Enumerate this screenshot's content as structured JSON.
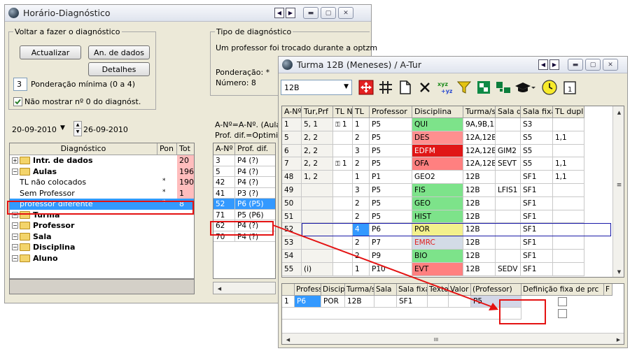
{
  "main_window": {
    "title": "Horário-Diagnóstico",
    "redo_group": {
      "label": "Voltar a fazer o diagnóstico",
      "update_button": "Actualizar",
      "analysis_button": "An. de dados",
      "details_button": "Detalhes",
      "min_weight_value": "3",
      "min_weight_label": "Ponderação mínima (0 a 4)",
      "hide_zero_label": "Não mostrar nº 0 do diagnóst."
    },
    "date_from": "20-09-2010",
    "date_to": "26-09-2010",
    "diag_type_group": {
      "label": "Tipo de diagnóstico",
      "description": "Um professor foi trocado durante a optzm",
      "weight_label": "Ponderação: *",
      "number_label": "Número: 8"
    },
    "legend_line1": "A-Nº=A-Nº. (Aula",
    "legend_line2": "Prof. dif.=Optimiz.",
    "tree": {
      "headers": [
        "Diagnóstico",
        "Pon",
        "Tot"
      ],
      "rows": [
        {
          "label": "Intr. de dados",
          "pon": "",
          "tot": "20",
          "bold": true,
          "folder": true,
          "expander": "+"
        },
        {
          "label": "Aulas",
          "pon": "",
          "tot": "196",
          "bold": true,
          "folder": true,
          "expander": "-"
        },
        {
          "label": "TL não colocados",
          "pon": "*",
          "tot": "190",
          "bold": false,
          "folder": false,
          "expander": ""
        },
        {
          "label": "Sem Professor",
          "pon": "*",
          "tot": "1",
          "bold": false,
          "folder": false,
          "expander": ""
        },
        {
          "label": "professor diferente",
          "pon": "*",
          "tot": "8",
          "bold": false,
          "folder": false,
          "expander": "",
          "selected": true
        },
        {
          "label": "Turma",
          "pon": "",
          "tot": "",
          "bold": true,
          "folder": true,
          "expander": "-"
        },
        {
          "label": "Professor",
          "pon": "",
          "tot": "",
          "bold": true,
          "folder": true,
          "expander": "-"
        },
        {
          "label": "Sala",
          "pon": "",
          "tot": "",
          "bold": true,
          "folder": true,
          "expander": "-"
        },
        {
          "label": "Disciplina",
          "pon": "",
          "tot": "",
          "bold": true,
          "folder": true,
          "expander": "-"
        },
        {
          "label": "Aluno",
          "pon": "",
          "tot": "",
          "bold": true,
          "folder": true,
          "expander": "-"
        }
      ]
    },
    "diff_list": {
      "headers": [
        "A-Nº",
        "Prof. dif."
      ],
      "rows": [
        {
          "an": "3",
          "prof": "P4 (?)"
        },
        {
          "an": "5",
          "prof": "P4 (?)"
        },
        {
          "an": "42",
          "prof": "P4 (?)"
        },
        {
          "an": "41",
          "prof": "P3 (?)"
        },
        {
          "an": "52",
          "prof": "P6 (P5)",
          "selected": true
        },
        {
          "an": "71",
          "prof": "P5 (P6)"
        },
        {
          "an": "62",
          "prof": "P4 (?)"
        },
        {
          "an": "70",
          "prof": "P4 (?)"
        }
      ]
    }
  },
  "class_window": {
    "title": "Turma 12B (Meneses) / A-Tur",
    "class_select": "12B",
    "toolbar_icons": [
      "move-icon",
      "grid-icon",
      "new-document-icon",
      "delete-icon",
      "sort-icon",
      "filter-icon",
      "lesson-sequence-icon",
      "couple-icon",
      "academic-cap-icon",
      "clock-icon",
      "calendar-icon"
    ],
    "lessons": {
      "headers": [
        "A-Nº",
        "Tur,Prf",
        "TL N",
        "TL",
        "Professor",
        "Disciplina",
        "Turma/s",
        "Sala d",
        "Sala fixa",
        "TL dupl"
      ],
      "rows": [
        {
          "an": "1",
          "turprf": "5, 1",
          "tln": "1",
          "lock": true,
          "tl": "1",
          "prof": "P5",
          "disc": "QUI",
          "disc_color": "#7de38a",
          "turmas": "9A,9B,12",
          "sala": "",
          "fixa": "S3",
          "dupl": ""
        },
        {
          "an": "5",
          "turprf": "2, 2",
          "tln": "",
          "lock": false,
          "tl": "2",
          "prof": "P5",
          "disc": "DES",
          "disc_color": "#ff8f8f",
          "turmas": "12A,12B",
          "sala": "",
          "fixa": "S5",
          "dupl": "1,1"
        },
        {
          "an": "6",
          "turprf": "2, 2",
          "tln": "",
          "lock": false,
          "tl": "3",
          "prof": "P5",
          "disc": "EDFM",
          "disc_color": "#e01616",
          "disc_text": "#ffffff",
          "turmas": "12A,12B",
          "sala": "GIM2",
          "fixa": "S5",
          "dupl": ""
        },
        {
          "an": "7",
          "turprf": "2, 2",
          "tln": "1",
          "lock": true,
          "tl": "2",
          "prof": "P5",
          "disc": "OFA",
          "disc_color": "#ff8080",
          "turmas": "12A,12B",
          "sala": "SEVT",
          "fixa": "S5",
          "dupl": "1,1"
        },
        {
          "an": "48",
          "turprf": "1, 2",
          "tln": "",
          "lock": false,
          "tl": "1",
          "prof": "P1",
          "disc": "GEO2",
          "disc_color": "",
          "turmas": "12B",
          "sala": "",
          "fixa": "SF1",
          "dupl": "1,1"
        },
        {
          "an": "49",
          "turprf": "",
          "tln": "",
          "lock": false,
          "tl": "3",
          "prof": "P5",
          "disc": "FIS",
          "disc_color": "#7de38a",
          "turmas": "12B",
          "sala": "LFIS1",
          "fixa": "SF1",
          "dupl": ""
        },
        {
          "an": "50",
          "turprf": "",
          "tln": "",
          "lock": false,
          "tl": "2",
          "prof": "P5",
          "disc": "GEO",
          "disc_color": "#7de38a",
          "turmas": "12B",
          "sala": "",
          "fixa": "SF1",
          "dupl": ""
        },
        {
          "an": "51",
          "turprf": "",
          "tln": "",
          "lock": false,
          "tl": "2",
          "prof": "P5",
          "disc": "HIST",
          "disc_color": "#7de38a",
          "turmas": "12B",
          "sala": "",
          "fixa": "SF1",
          "dupl": ""
        },
        {
          "an": "52",
          "turprf": "",
          "tln": "",
          "lock": false,
          "tl": "4",
          "prof": "P6",
          "disc": "POR",
          "disc_color": "#f3f08c",
          "turmas": "12B",
          "sala": "",
          "fixa": "SF1",
          "dupl": "",
          "selected": true
        },
        {
          "an": "53",
          "turprf": "",
          "tln": "",
          "lock": false,
          "tl": "2",
          "prof": "P7",
          "disc": "EMRC",
          "disc_color": "#d3dbe6",
          "disc_text": "#e02020",
          "turmas": "12B",
          "sala": "",
          "fixa": "SF1",
          "dupl": ""
        },
        {
          "an": "54",
          "turprf": "",
          "tln": "",
          "lock": false,
          "tl": "2",
          "prof": "P9",
          "disc": "BIO",
          "disc_color": "#7de38a",
          "turmas": "12B",
          "sala": "",
          "fixa": "SF1",
          "dupl": ""
        },
        {
          "an": "55",
          "turprf": "(i)",
          "tln": "",
          "lock": false,
          "tl": "1",
          "prof": "P10",
          "disc": "EVT",
          "disc_color": "#ff8080",
          "turmas": "12B",
          "sala": "SEDV",
          "fixa": "SF1",
          "dupl": ""
        }
      ]
    },
    "detail": {
      "headers": [
        "Profess",
        "Discip",
        "Turma/s",
        "Sala",
        "Sala fixa",
        "Texto",
        "Valor",
        "(Professor)",
        "Definição fixa de prc",
        "F"
      ],
      "rows": [
        {
          "num": "1",
          "prof": "P6",
          "disc": "POR",
          "turmas": "12B",
          "sala": "",
          "fixa": "SF1",
          "texto": "",
          "valor": "",
          "orig_prof": "P5"
        }
      ],
      "scroll_marker": "III"
    }
  }
}
